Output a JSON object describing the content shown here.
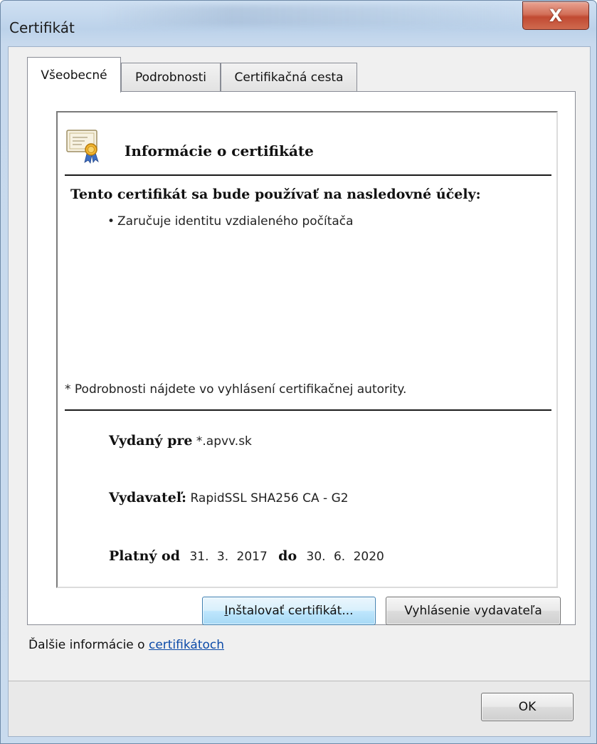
{
  "window": {
    "title": "Certifikát",
    "close_glyph": "X"
  },
  "tabs": [
    {
      "label": "Všeobecné",
      "active": true
    },
    {
      "label": "Podrobnosti",
      "active": false
    },
    {
      "label": "Certifikačná cesta",
      "active": false
    }
  ],
  "info": {
    "icon": "certificate-icon",
    "heading": "Informácie o certifikáte",
    "purpose_heading": "Tento certifikát sa bude používať na nasledovné účely:",
    "purposes": [
      {
        "bullet": "•",
        "text": "Zaručuje identitu vzdialeného počítača"
      }
    ],
    "footnote": "* Podrobnosti nájdete vo vyhlásení certifikačnej autority.",
    "issued_to_label": "Vydaný pre",
    "issued_to_value": "*.apvv.sk",
    "issuer_label": "Vydavateľ:",
    "issuer_value": "RapidSSL SHA256 CA - G2",
    "valid_from_label": "Platný od",
    "valid_from_value": "31. 3. 2017",
    "valid_to_label": "do",
    "valid_to_value": "30. 6. 2020"
  },
  "buttons": {
    "install_mnemonic": "I",
    "install_rest": "nštalovať certifikát...",
    "issuer_statement": "Vyhlásenie vydavateľa",
    "ok": "OK"
  },
  "more_info": {
    "prefix": "Ďalšie informácie o ",
    "link": "certifikátoch"
  },
  "colors": {
    "link": "#0b4aa8",
    "close_button": "#c14a32",
    "focused_button_border": "#3c7fb1"
  }
}
